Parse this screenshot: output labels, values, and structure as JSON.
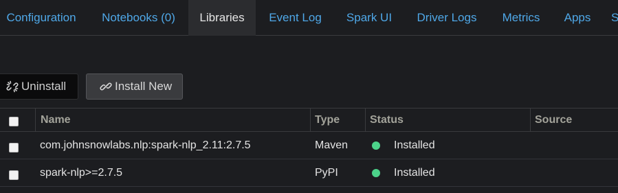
{
  "tabs": [
    {
      "label": "Configuration",
      "active": false
    },
    {
      "label": "Notebooks (0)",
      "active": false
    },
    {
      "label": "Libraries",
      "active": true
    },
    {
      "label": "Event Log",
      "active": false
    },
    {
      "label": "Spark UI",
      "active": false
    },
    {
      "label": "Driver Logs",
      "active": false
    },
    {
      "label": "Metrics",
      "active": false
    },
    {
      "label": "Apps",
      "active": false
    },
    {
      "label": "S",
      "active": false
    }
  ],
  "toolbar": {
    "uninstall_label": "Uninstall",
    "install_label": "Install New"
  },
  "table": {
    "headers": {
      "name": "Name",
      "type": "Type",
      "status": "Status",
      "source": "Source"
    },
    "rows": [
      {
        "name": "com.johnsnowlabs.nlp:spark-nlp_2.11:2.7.5",
        "type": "Maven",
        "status": "Installed",
        "source": ""
      },
      {
        "name": "spark-nlp>=2.7.5",
        "type": "PyPI",
        "status": "Installed",
        "source": ""
      }
    ]
  },
  "colors": {
    "background": "#1c1d20",
    "tab_link": "#4fa8e8",
    "active_tab_bg": "#2b2c2f",
    "status_installed": "#4cd38a"
  }
}
